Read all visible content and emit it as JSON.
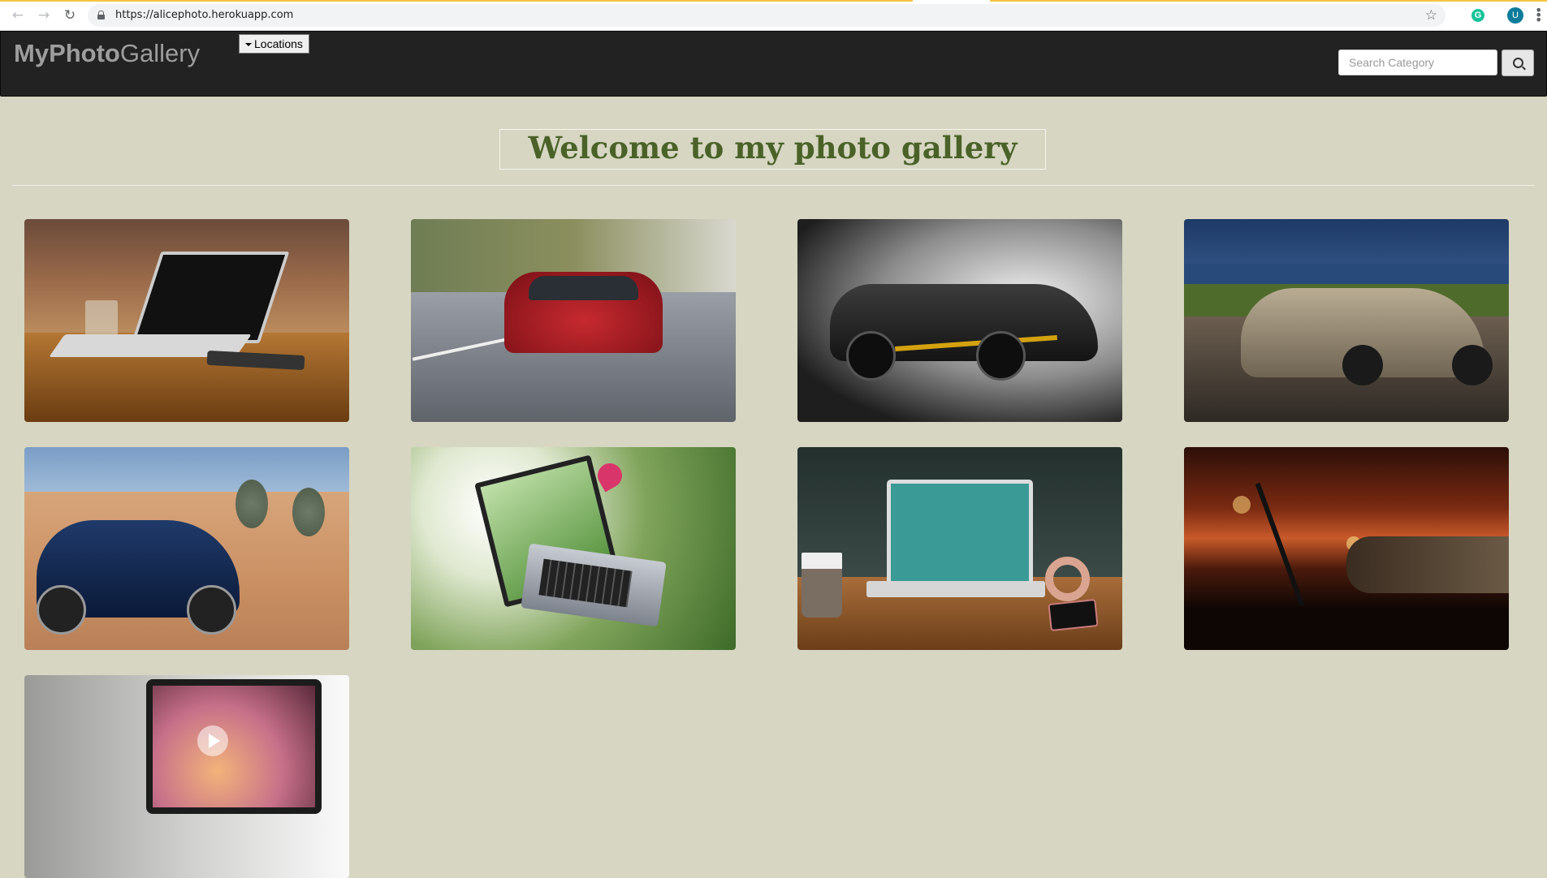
{
  "browser": {
    "url": "https://alicephoto.herokuapp.com",
    "profile_initial": "U",
    "grammarly_label": "G"
  },
  "navbar": {
    "brand_bold": "MyPhoto",
    "brand_light": "Gallery",
    "locations_label": "Locations",
    "search_placeholder": "Search Category"
  },
  "main": {
    "heading": "Welcome to my photo gallery"
  },
  "gallery": {
    "photos": [
      {
        "subject": "laptop on wooden table"
      },
      {
        "subject": "red sedan on road"
      },
      {
        "subject": "black supercar"
      },
      {
        "subject": "silver sports car at dusk"
      },
      {
        "subject": "blue electric car in desert"
      },
      {
        "subject": "laptop with pink flower"
      },
      {
        "subject": "laptop on desk with coffee and headphones"
      },
      {
        "subject": "laptop silhouette at sunset"
      },
      {
        "subject": "laptop playing video"
      }
    ]
  },
  "colors": {
    "page_background": "#d6d6c2",
    "navbar_background": "#222222",
    "brand_text": "#9d9d9d",
    "heading_text": "#4a6228"
  }
}
